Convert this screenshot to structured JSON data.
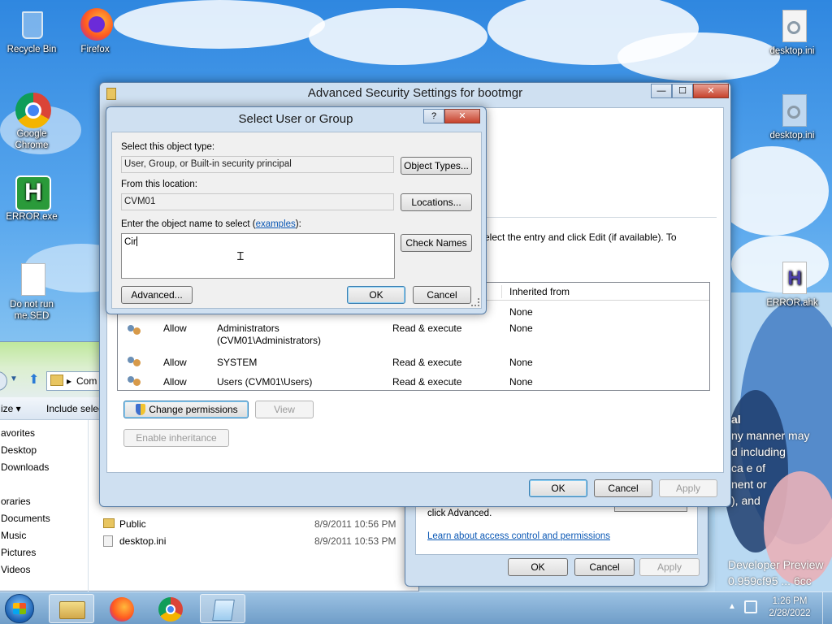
{
  "desktop_icons": [
    {
      "label": "Recycle Bin"
    },
    {
      "label": "Firefox"
    },
    {
      "label": "Google Chrome"
    },
    {
      "label": "ERROR.exe"
    },
    {
      "label": "Do not run me.SED"
    },
    {
      "label": "desktop.ini"
    },
    {
      "label": "desktop.ini"
    },
    {
      "label": "ERROR.ahk"
    }
  ],
  "explorer": {
    "address": "Com",
    "toolbar_organize": "ize ▾",
    "toolbar_include": "Include selec",
    "nav_items": [
      "avorites",
      "Desktop",
      "Downloads",
      "oraries",
      "Documents",
      "Music",
      "Pictures",
      "Videos"
    ],
    "files": [
      {
        "name": "Public",
        "date": "8/9/2011 10:56 PM"
      },
      {
        "name": "desktop.ini",
        "date": "8/9/2011 10:53 PM"
      }
    ]
  },
  "properties_dialog": {
    "click_advanced": "click Advanced.",
    "learn_link": "Learn about access control and permissions",
    "ok": "OK",
    "cancel": "Cancel",
    "apply": "Apply"
  },
  "adv_window": {
    "title": "Advanced Security Settings for bootmgr",
    "instruction": "elect the entry and click Edit (if available). To",
    "col_inherited": "Inherited from",
    "rows": [
      {
        "type": "",
        "principal": "",
        "access": "",
        "inherited": "None"
      },
      {
        "type": "Allow",
        "principal": "Administrators (CVM01\\Administrators)",
        "access": "Read & execute",
        "inherited": "None"
      },
      {
        "type": "Allow",
        "principal": "SYSTEM",
        "access": "Read & execute",
        "inherited": "None"
      },
      {
        "type": "Allow",
        "principal": "Users (CVM01\\Users)",
        "access": "Read & execute",
        "inherited": "None"
      }
    ],
    "change_permissions": "Change permissions",
    "view": "View",
    "enable_inheritance": "Enable inheritance",
    "ok": "OK",
    "cancel": "Cancel",
    "apply": "Apply"
  },
  "select_dialog": {
    "title": "Select User or Group",
    "help": "?",
    "close": "✕",
    "object_type_label": "Select this object type:",
    "object_type_value": "User, Group, or Built-in security principal",
    "object_types_button": "Object Types...",
    "location_label": "From this location:",
    "location_value": "CVM01",
    "locations_button": "Locations...",
    "enter_name_label": "Enter the object name to select (",
    "examples_link": "examples",
    "enter_name_suffix": "):",
    "name_value": "Cir",
    "check_names_button": "Check Names",
    "advanced_button": "Advanced...",
    "ok_button": "OK",
    "cancel_button": "Cancel"
  },
  "wallpaper_text": {
    "line1": "al",
    "line2": "ny manner may",
    "line3": "d including",
    "line4": "ca e of",
    "line5": "nent or",
    "line6": "), and",
    "developer": "Developer Preview",
    "build": "0.959cf95 ... 6cc"
  },
  "taskbar": {
    "time": "1:26 PM",
    "date": "2/28/2022"
  },
  "colors": {
    "accent_link": "#0b58b5",
    "wallpaper_sky": "#2f87e0"
  }
}
